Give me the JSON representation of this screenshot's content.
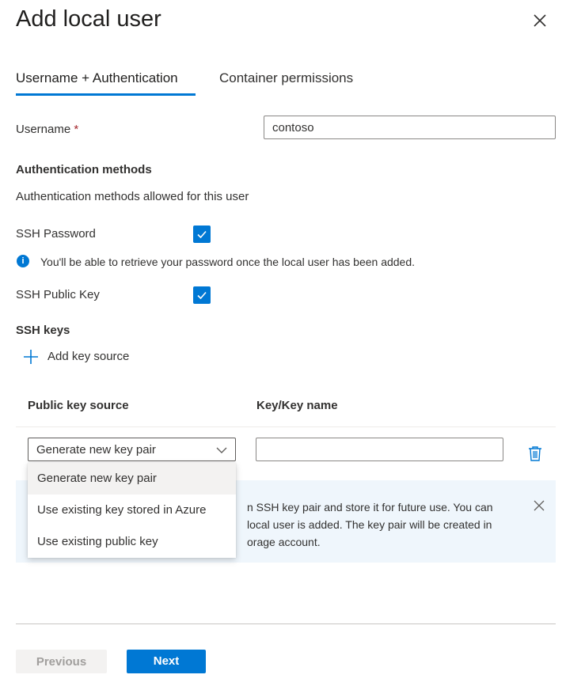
{
  "header": {
    "title": "Add local user",
    "close_icon": "close-icon"
  },
  "tabs": [
    {
      "label": "Username + Authentication",
      "active": true
    },
    {
      "label": "Container permissions",
      "active": false
    }
  ],
  "username": {
    "label": "Username",
    "required_mark": "*",
    "value": "contoso"
  },
  "auth": {
    "heading": "Authentication methods",
    "description": "Authentication methods allowed for this user",
    "ssh_password": {
      "label": "SSH Password",
      "checked": true
    },
    "info": "You'll be able to retrieve your password once the local user has been added.",
    "ssh_public_key": {
      "label": "SSH Public Key",
      "checked": true
    }
  },
  "ssh_keys": {
    "heading": "SSH keys",
    "add_label": "Add key source",
    "columns": [
      "Public key source",
      "Key/Key name"
    ],
    "row": {
      "source_selected": "Generate new key pair",
      "key_name": ""
    },
    "dropdown_options": [
      "Generate new key pair",
      "Use existing key stored in Azure",
      "Use existing public key"
    ],
    "banner_lines": [
      "n SSH key pair and store it for future use. You can",
      "local user is added. The key pair will be created in",
      "orage account."
    ]
  },
  "footer": {
    "previous_label": "Previous",
    "next_label": "Next"
  },
  "colors": {
    "accent": "#0078d4",
    "banner_bg": "#eff6fc",
    "required": "#a4262c"
  }
}
